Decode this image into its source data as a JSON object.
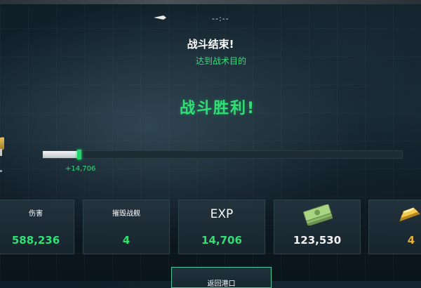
{
  "hud": {
    "timer": "--:--"
  },
  "result": {
    "title": "战斗结束!",
    "subtitle": "达到战术目的",
    "victory": "战斗胜利!"
  },
  "experience": {
    "gain_text": "+14,706",
    "progress_fraction": 0.1
  },
  "stats": [
    {
      "label": "伤害",
      "value": "588,236"
    },
    {
      "label": "摧毁战舰",
      "value": "4"
    },
    {
      "label": "EXP",
      "value": "14,706"
    },
    {
      "icon": "cash-stack-icon",
      "value": "123,530"
    },
    {
      "icon": "gold-bars-icon",
      "value": "4"
    }
  ],
  "colors": {
    "accent_green": "#2fe074",
    "gold": "#e0b13a"
  },
  "bottom_button": {
    "label": "返回港口"
  }
}
